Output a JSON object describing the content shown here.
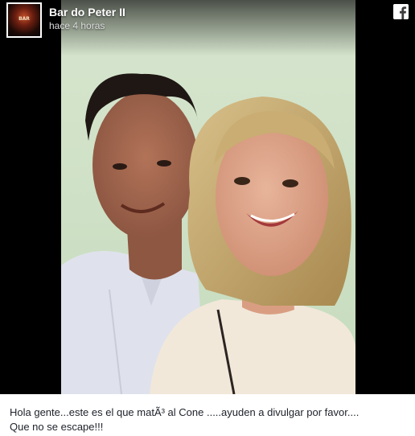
{
  "post": {
    "page_name": "Bar do Peter II",
    "timestamp": "hace 4 horas",
    "avatar_icon": "bar-logo-icon",
    "platform_icon": "facebook-icon",
    "caption_line1": "Hola gente...este es el que matÃ³ al Cone .....ayuden a divulgar por favor....",
    "caption_line2": "Que no se escape!!!"
  },
  "colors": {
    "media_background": "#000000",
    "caption_text": "#1d2129",
    "header_text": "#ffffff",
    "timestamp_text": "#dddddd"
  }
}
